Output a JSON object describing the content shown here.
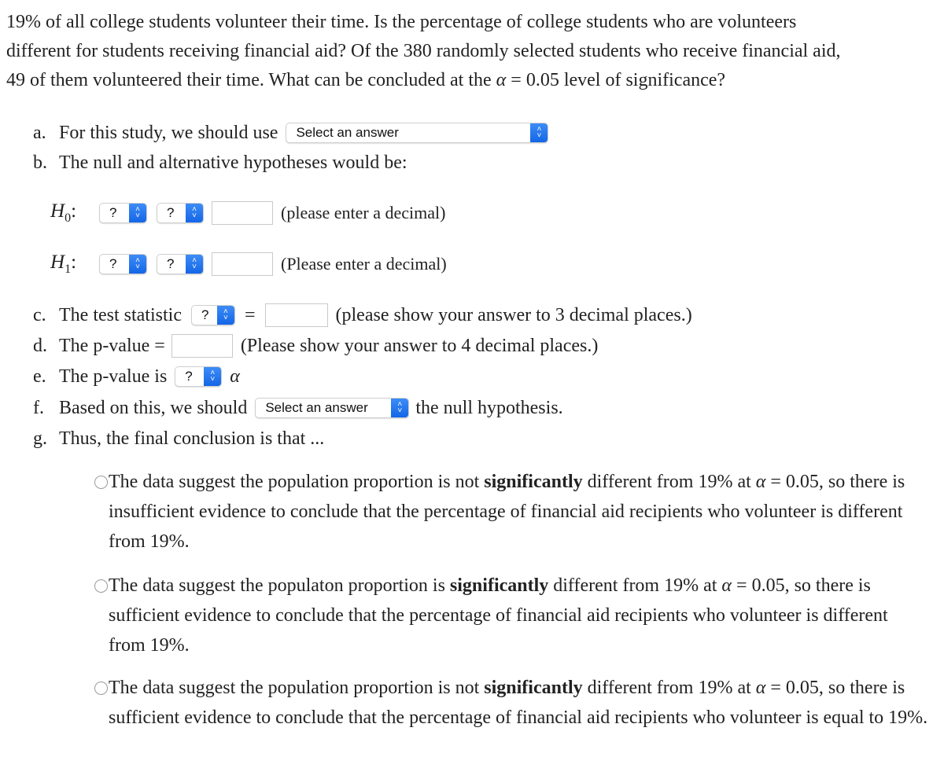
{
  "question": {
    "line1": "19% of all college students volunteer their time. Is the percentage of college students who are volunteers",
    "line2": "different for students receiving financial aid? Of the 380 randomly selected students who receive financial aid,",
    "line3_pre": "49 of them volunteered their time. What can be concluded at the ",
    "alpha_symbol": "α",
    "line3_post": " = 0.05 level of significance?"
  },
  "part_a": {
    "marker": "a.",
    "text": "For this study, we should use",
    "select_value": "Select an answer"
  },
  "part_b": {
    "marker": "b.",
    "text": "The null and alternative hypotheses would be:"
  },
  "h0": {
    "label": "H",
    "sub": "0",
    "colon": ":",
    "select1": "?",
    "select2": "?",
    "input_value": "",
    "hint": "(please enter a decimal)"
  },
  "h1": {
    "label": "H",
    "sub": "1",
    "colon": ":",
    "select1": "?",
    "select2": "?",
    "input_value": "",
    "hint": "(Please enter a decimal)"
  },
  "part_c": {
    "marker": "c.",
    "text": "The test statistic",
    "select_value": "?",
    "equals": "=",
    "input_value": "",
    "hint": "(please show your answer to 3 decimal places.)"
  },
  "part_d": {
    "marker": "d.",
    "text": "The p-value =",
    "input_value": "",
    "hint": "(Please show your answer to 4 decimal places.)"
  },
  "part_e": {
    "marker": "e.",
    "text": "The p-value is",
    "select_value": "?",
    "alpha": "α"
  },
  "part_f": {
    "marker": "f.",
    "text": "Based on this, we should",
    "select_value": "Select an answer",
    "text_after": "the null hypothesis."
  },
  "part_g": {
    "marker": "g.",
    "text": "Thus, the final conclusion is that ..."
  },
  "options": [
    {
      "pre": "The data suggest the population proportion is not ",
      "bold": "significantly",
      "mid": " different from 19% at ",
      "alpha": "α",
      "post": " = 0.05, so there is insufficient evidence to conclude that the percentage of financial aid recipients who volunteer is different from 19%.",
      "selected": false
    },
    {
      "pre": "The data suggest the populaton proportion is ",
      "bold": "significantly",
      "mid": " different from 19% at ",
      "alpha": "α",
      "post": " = 0.05, so there is sufficient evidence to conclude that the percentage of financial aid recipients who volunteer is different from 19%.",
      "selected": false
    },
    {
      "pre": "The data suggest the population proportion is not ",
      "bold": "significantly",
      "mid": " different from 19% at ",
      "alpha": "α",
      "post": " = 0.05, so there is sufficient evidence to conclude that the percentage of financial aid recipients who volunteer is equal to 19%.",
      "selected": false
    }
  ]
}
